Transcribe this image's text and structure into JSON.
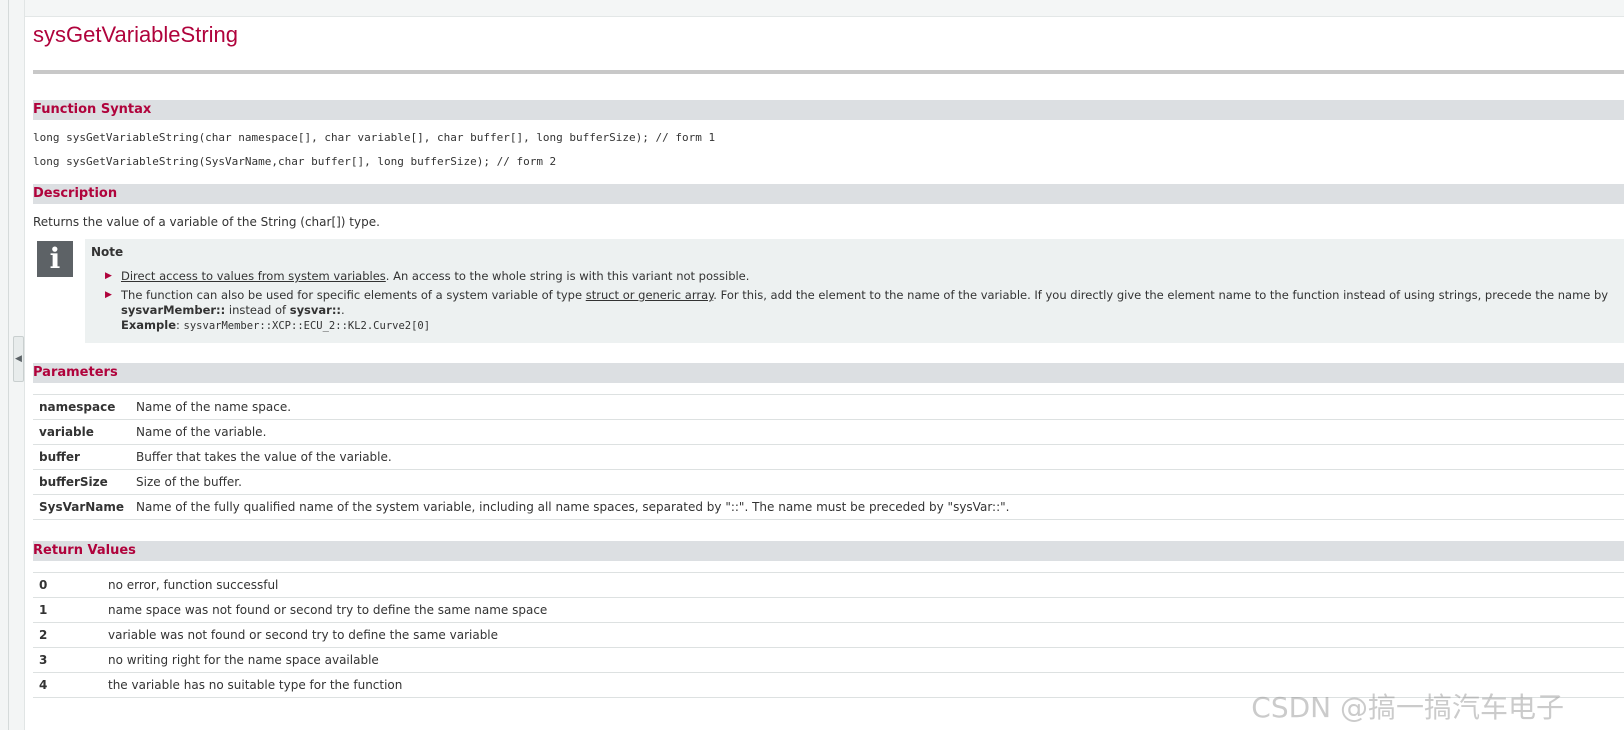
{
  "title": "sysGetVariableString",
  "syntax": {
    "heading": "Function Syntax",
    "lines": [
      "long sysGetVariableString(char namespace[], char variable[], char buffer[], long bufferSize); // form 1",
      "long sysGetVariableString(SysVarName,char buffer[], long bufferSize); // form 2"
    ]
  },
  "description": {
    "heading": "Description",
    "text": "Returns the value of a variable of the String (char[]) type."
  },
  "note": {
    "icon": "info-icon",
    "title": "Note",
    "item1": {
      "link": "Direct access to values from system variables",
      "rest": ". An access to the whole string is with this variant not possible."
    },
    "item2": {
      "text1": "The function can also be used for specific elements of a system variable of type ",
      "link": "struct or generic array",
      "text2": ". For this, add the element to the name of the variable. If you directly give the element name to the function instead of using strings, precede the name by ",
      "bold1": "sysvarMember::",
      "text3": " instead of ",
      "bold2": "sysvar::",
      "text4": ".",
      "example_label": "Example",
      "example_sep": ": ",
      "example_code": "sysvarMember::XCP::ECU_2::KL2.Curve2[0]"
    }
  },
  "parameters": {
    "heading": "Parameters",
    "rows": [
      {
        "name": "namespace",
        "desc": "Name of the name space."
      },
      {
        "name": "variable",
        "desc": "Name of the variable."
      },
      {
        "name": "buffer",
        "desc": "Buffer that takes the value of the variable."
      },
      {
        "name": "bufferSize",
        "desc": "Size of the buffer."
      },
      {
        "name": "SysVarName",
        "desc": "Name of the fully qualified name of the system variable, including all name spaces, separated by \"::\". The name must be preceded by \"sysVar::\"."
      }
    ]
  },
  "return_values": {
    "heading": "Return Values",
    "rows": [
      {
        "code": "0",
        "desc": "no error, function successful"
      },
      {
        "code": "1",
        "desc": "name space was not found or second try to define the same name space"
      },
      {
        "code": "2",
        "desc": "variable was not found or second try to define the same variable"
      },
      {
        "code": "3",
        "desc": "no writing right for the name space available"
      },
      {
        "code": "4",
        "desc": "the variable has no suitable type for the function"
      }
    ]
  },
  "watermark": "CSDN @搞一搞汽车电子"
}
